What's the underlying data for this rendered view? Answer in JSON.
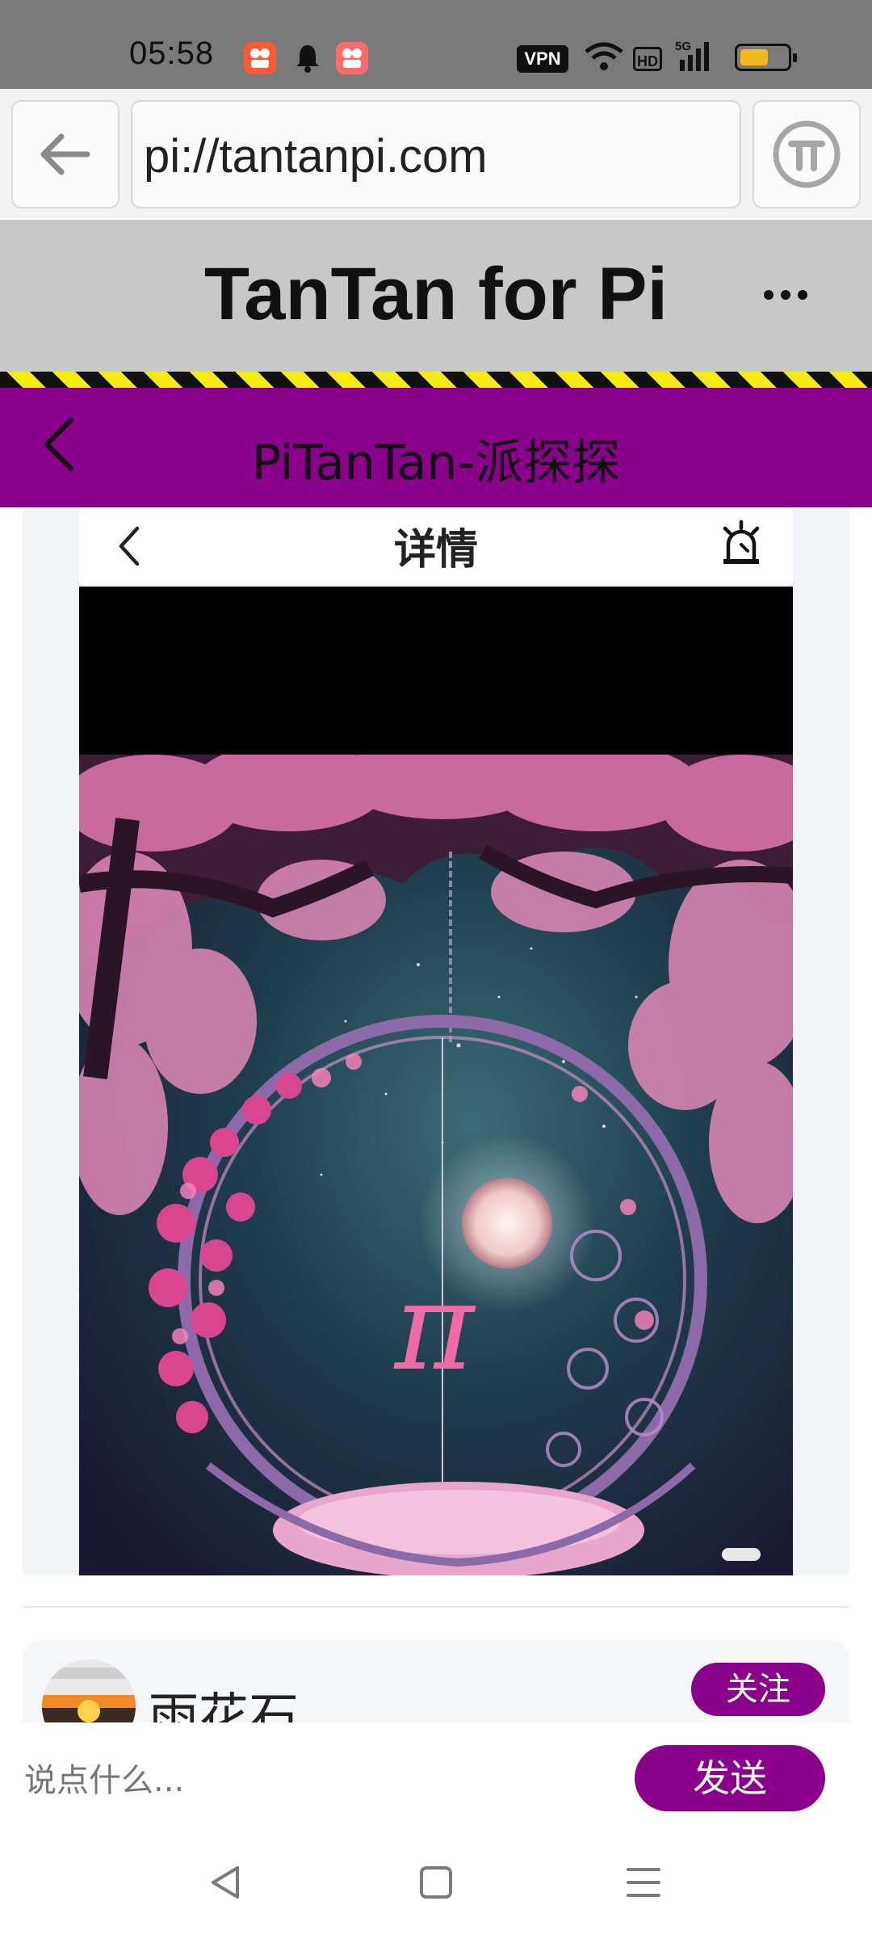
{
  "status_bar": {
    "time": "05:58",
    "vpn_label": "VPN",
    "hd_label": "HD",
    "network_label": "5G",
    "battery_level": 0.6,
    "battery_color": "#f3b81b"
  },
  "browser": {
    "url": "pi://tantanpi.com"
  },
  "site": {
    "title": "TanTan for Pi"
  },
  "app_header": {
    "title": "PiTanTan-派探探",
    "color": "#8b008b"
  },
  "detail": {
    "title": "详情"
  },
  "post": {
    "username": "雨花石",
    "follow_label": "关注"
  },
  "comment": {
    "placeholder": "说点什么...",
    "send_label": "发送"
  },
  "icons": [
    "arrow-left-icon",
    "pi-icon",
    "more-icon",
    "chevron-left-icon",
    "alarm-icon",
    "bell-icon",
    "wifi-icon",
    "signal-icon",
    "battery-icon",
    "nav-back-icon",
    "nav-home-icon",
    "nav-menu-icon"
  ]
}
